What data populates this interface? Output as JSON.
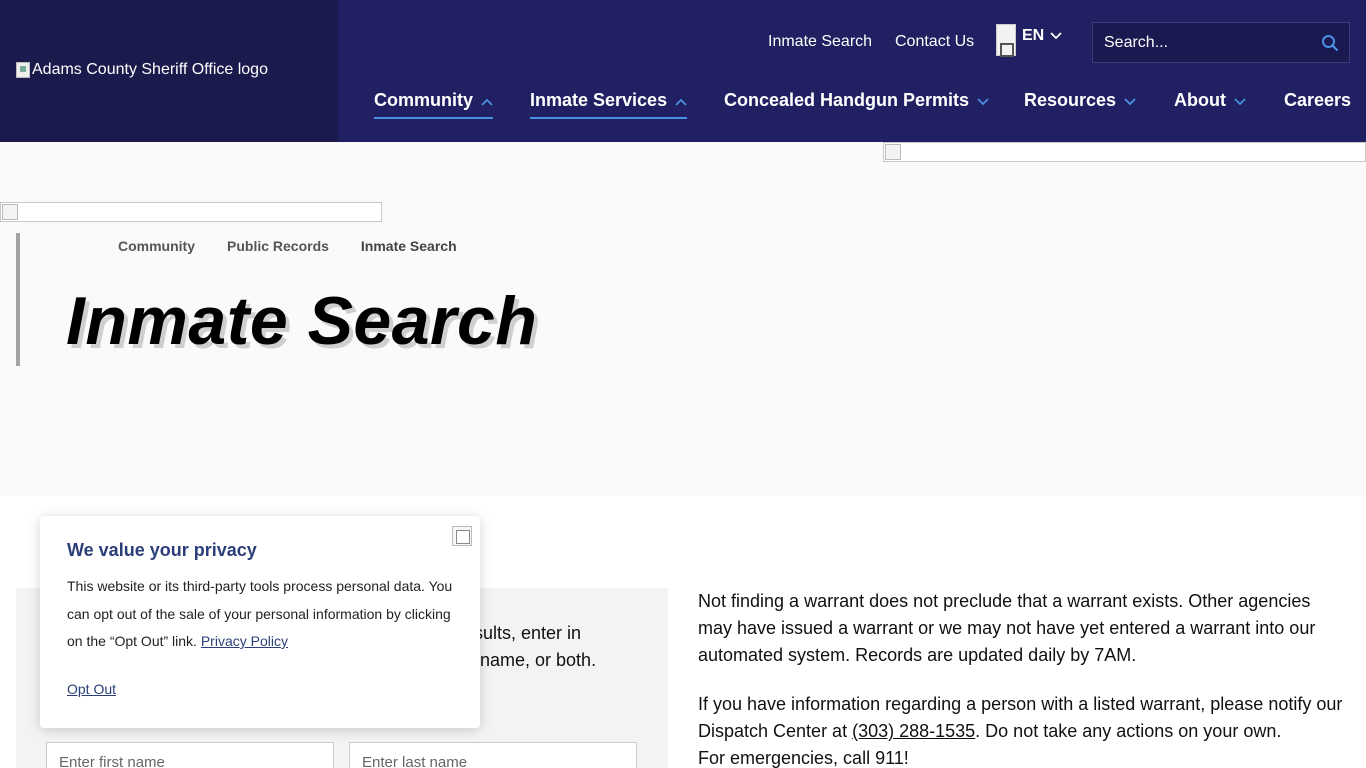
{
  "header": {
    "logo_alt": "Adams County Sheriff Office logo",
    "utility_links": [
      "Inmate Search",
      "Contact Us"
    ],
    "language": {
      "code": "EN"
    },
    "search": {
      "placeholder": "Search..."
    },
    "nav": [
      {
        "label": "Community",
        "expanded": true
      },
      {
        "label": "Inmate Services",
        "expanded": true
      },
      {
        "label": "Concealed Handgun Permits",
        "expanded": false
      },
      {
        "label": "Resources",
        "expanded": false
      },
      {
        "label": "About",
        "expanded": false
      },
      {
        "label": "Careers",
        "expanded": false
      }
    ]
  },
  "breadcrumb": [
    "Community",
    "Public Records",
    "Inmate Search"
  ],
  "page_title": "Inmate Search",
  "form": {
    "instructions_line1": "results, enter in",
    "instructions_line2": "name, or both.",
    "first_name_placeholder": "Enter first name",
    "last_name_placeholder": "Enter last name"
  },
  "info": {
    "para1": "Not finding a warrant does not preclude that a warrant exists. Other agencies may have issued a warrant or we may not have yet entered a warrant into our automated system. Records are updated daily by 7AM.",
    "para2_before": "If you have information regarding a person with a listed warrant, please notify our Dispatch Center at ",
    "phone": "(303) 288-1535",
    "para2_after": ". Do not take any actions on your own.",
    "emergency": "For emergencies, call 911!"
  },
  "privacy": {
    "title": "We value your privacy",
    "body": "This website or its third-party tools process personal data. You can opt out of the sale of your personal information by clicking on the “Opt Out” link.",
    "policy_link": "Privacy Policy",
    "opt_out": "Opt Out"
  },
  "colors": {
    "header_bg": "#212062",
    "logo_bg": "#1b1a4d",
    "accent": "#4a90e2",
    "privacy_title": "#2c3e7a"
  }
}
